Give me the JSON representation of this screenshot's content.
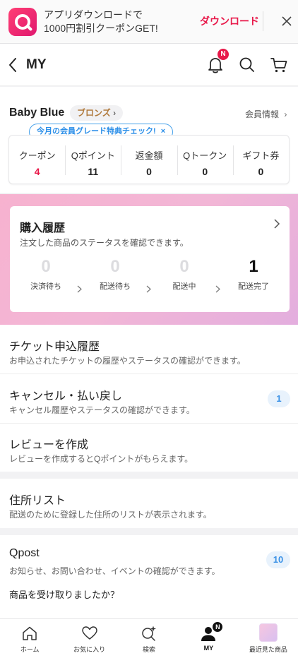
{
  "banner": {
    "app_icon": "qoo10-app-icon",
    "line1": "アプリダウンロードで",
    "line2": "1000円割引クーポンGET!",
    "download_label": "ダウンロード"
  },
  "header": {
    "title": "MY",
    "notification_count": "N"
  },
  "profile": {
    "name": "Baby Blue",
    "grade": "ブロンズ",
    "grade_tip": "今月の会員グレード特典チェック!",
    "member_info_label": "会員情報",
    "stats": [
      {
        "label": "クーポン",
        "value": "4"
      },
      {
        "label": "Qポイント",
        "value": "11"
      },
      {
        "label": "返金額",
        "value": "0"
      },
      {
        "label": "Qトークン",
        "value": "0"
      },
      {
        "label": "ギフト券",
        "value": "0"
      }
    ]
  },
  "purchase": {
    "title": "購入履歴",
    "description": "注文した商品のステータスを確認できます。",
    "steps": [
      {
        "count": "0",
        "label": "決済待ち"
      },
      {
        "count": "0",
        "label": "配送待ち"
      },
      {
        "count": "0",
        "label": "配送中"
      },
      {
        "count": "1",
        "label": "配送完了"
      }
    ]
  },
  "menu": {
    "tickets": {
      "title": "チケット申込履歴",
      "desc": "お申込されたチケットの履歴やステータスの確認ができます。"
    },
    "cancel": {
      "title": "キャンセル・払い戻し",
      "desc": "キャンセル履歴やステータスの確認ができます。",
      "badge": "1"
    },
    "review": {
      "title": "レビューを作成",
      "desc": "レビューを作成するとQポイントがもらえます。"
    },
    "address": {
      "title": "住所リスト",
      "desc": "配送のために登録した住所のリストが表示されます。"
    },
    "qpost": {
      "title": "Qpost",
      "desc": "お知らせ、お問い合わせ、イベントの確認ができます。",
      "badge": "10"
    },
    "received": {
      "title": "商品を受け取りましたか？"
    }
  },
  "bottom_nav": {
    "items": [
      {
        "label": "ホーム",
        "icon": "home-icon"
      },
      {
        "label": "お気に入り",
        "icon": "heart-icon"
      },
      {
        "label": "検索",
        "icon": "search-sparkle-icon"
      },
      {
        "label": "MY",
        "icon": "person-icon",
        "badge": "N"
      },
      {
        "label": "最近見た商品",
        "icon": "product-thumbnail"
      }
    ]
  },
  "colors": {
    "accent_red": "#e8194a",
    "tip_blue": "#2a8ee8",
    "grade_bronze": "#b07a3c",
    "pink_gradient_start": "#f7b2cf",
    "pink_gradient_end": "#e3aede"
  }
}
